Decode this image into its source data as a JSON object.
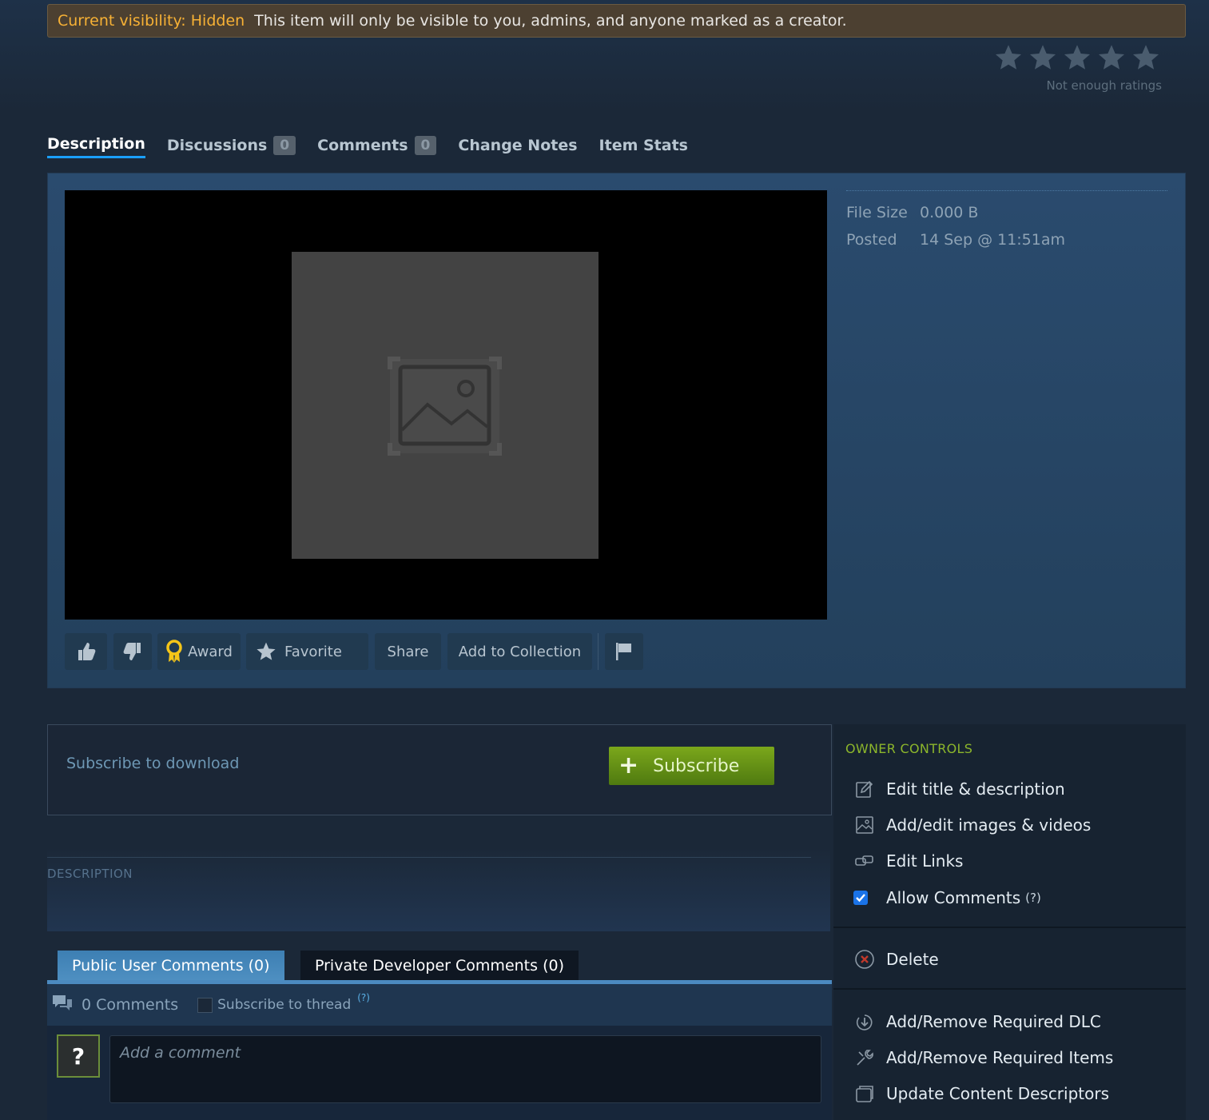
{
  "visibility": {
    "label": "Current visibility: Hidden",
    "message": "This item will only be visible to you, admins, and anyone marked as a creator."
  },
  "rating": {
    "stars": 5,
    "text": "Not enough ratings"
  },
  "tabs": [
    {
      "label": "Description",
      "active": true
    },
    {
      "label": "Discussions",
      "count": "0"
    },
    {
      "label": "Comments",
      "count": "0"
    },
    {
      "label": "Change Notes"
    },
    {
      "label": "Item Stats"
    }
  ],
  "details": {
    "file_size_key": "File Size",
    "file_size_val": "0.000 B",
    "posted_key": "Posted",
    "posted_val": "14 Sep @ 11:51am"
  },
  "actions": {
    "thumbs_up_icon": "thumbs-up-icon",
    "thumbs_down_icon": "thumbs-down-icon",
    "award": "Award",
    "favorite": "Favorite",
    "share": "Share",
    "add_to_collection": "Add to Collection",
    "flag_icon": "flag-icon"
  },
  "subscribe": {
    "prompt": "Subscribe to download",
    "button": "Subscribe"
  },
  "description": {
    "title": "DESCRIPTION"
  },
  "comments": {
    "public_tab": "Public User Comments (0)",
    "private_tab": "Private Developer Comments (0)",
    "count": "0 Comments",
    "subscribe_thread": "Subscribe to thread",
    "help": "(?)",
    "avatar": "?",
    "placeholder": "Add a comment"
  },
  "owner_controls": {
    "title": "OWNER CONTROLS",
    "edit_title": "Edit title & description",
    "edit_images": "Add/edit images & videos",
    "edit_links": "Edit Links",
    "allow_comments": "Allow Comments",
    "allow_comments_help": "(?)",
    "allow_comments_checked": true,
    "delete": "Delete",
    "required_dlc": "Add/Remove Required DLC",
    "required_items": "Add/Remove Required Items",
    "content_descriptors": "Update Content Descriptors"
  },
  "colors": {
    "background": "#1b2838",
    "visibility_label": "#f7b135",
    "tab_underline": "#1a9fff",
    "subscribe_green": "#75a31a",
    "owner_title": "#8cb62b"
  }
}
